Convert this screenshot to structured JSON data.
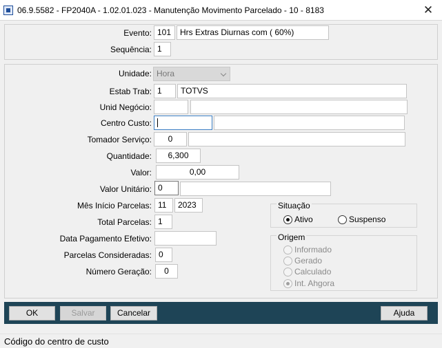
{
  "window": {
    "title": "06.9.5582 - FP2040A - 1.02.01.023 - Manutenção Movimento Parcelado - 10 - 8183",
    "close_glyph": "✕"
  },
  "form": {
    "evento": {
      "label": "Evento:",
      "code": "101",
      "description": "Hrs Extras Diurnas  com ( 60%)"
    },
    "sequencia": {
      "label": "Sequência:",
      "value": "1"
    },
    "unidade": {
      "label": "Unidade:",
      "value": "Hora"
    },
    "estab_trab": {
      "label": "Estab Trab:",
      "code": "1",
      "description": "TOTVS"
    },
    "unid_negocio": {
      "label": "Unid Negócio:",
      "code": "",
      "description": ""
    },
    "centro_custo": {
      "label": "Centro Custo:",
      "code": "",
      "description": ""
    },
    "tomador_servico": {
      "label": "Tomador Serviço:",
      "code": "0",
      "description": ""
    },
    "quantidade": {
      "label": "Quantidade:",
      "value": "6,300"
    },
    "valor": {
      "label": "Valor:",
      "value": "0,00"
    },
    "valor_unitario": {
      "label": "Valor Unitário:",
      "value": "0",
      "extra": ""
    },
    "mes_inicio_parcelas": {
      "label": "Mês Início Parcelas:",
      "month": "11",
      "year": "2023"
    },
    "total_parcelas": {
      "label": "Total Parcelas:",
      "value": "1"
    },
    "data_pagamento_efetivo": {
      "label": "Data Pagamento Efetivo:",
      "value": ""
    },
    "parcelas_consideradas": {
      "label": "Parcelas Consideradas:",
      "value": "0"
    },
    "numero_geracao": {
      "label": "Número Geração:",
      "value": "0"
    }
  },
  "situacao": {
    "title": "Situação",
    "options": [
      {
        "label": "Ativo",
        "selected": true
      },
      {
        "label": "Suspenso",
        "selected": false
      }
    ]
  },
  "origem": {
    "title": "Origem",
    "options": [
      {
        "label": "Informado",
        "selected": false
      },
      {
        "label": "Gerado",
        "selected": false
      },
      {
        "label": "Calculado",
        "selected": false
      },
      {
        "label": "Int. Ahgora",
        "selected": true
      }
    ]
  },
  "buttons": {
    "ok": "OK",
    "salvar": "Salvar",
    "cancelar": "Cancelar",
    "ajuda": "Ajuda"
  },
  "status": {
    "text": "Código do centro de custo"
  },
  "colors": {
    "button_bar": "#1e4456",
    "focus_border": "#3c7fc4",
    "background": "#f0f0f0"
  }
}
